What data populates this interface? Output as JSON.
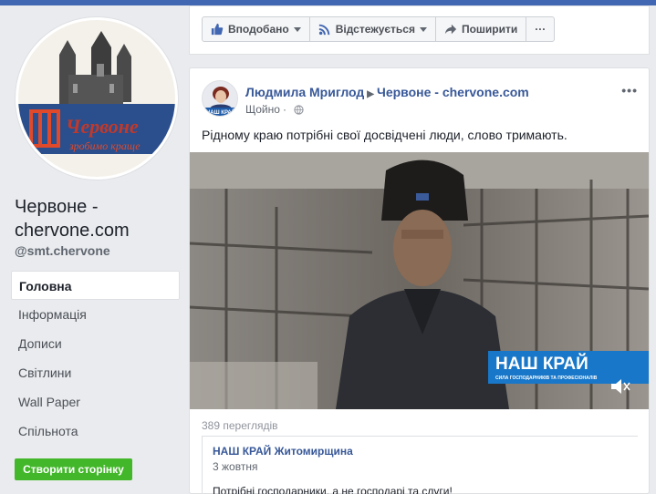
{
  "page": {
    "name": "Червоне - chervone.com",
    "handle": "@smt.chervone",
    "logo_text": "Червоне",
    "logo_tagline": "зробимо краще"
  },
  "nav": {
    "items": [
      {
        "label": "Головна",
        "active": true
      },
      {
        "label": "Інформація",
        "active": false
      },
      {
        "label": "Дописи",
        "active": false
      },
      {
        "label": "Світлини",
        "active": false
      },
      {
        "label": "Wall Paper",
        "active": false
      },
      {
        "label": "Спільнота",
        "active": false
      }
    ]
  },
  "create_page_label": "Створити сторінку",
  "actions": {
    "like": "Вподобано",
    "follow": "Відстежується",
    "share": "Поширити",
    "more": "···"
  },
  "post": {
    "author": "Людмила Мриглод",
    "target_page": "Червоне - chervone.com",
    "time": "Щойно",
    "avatar_badge": "НАШ КРАЙ",
    "text": "Рідному краю потрібні свої досвідчені люди, слово тримають.",
    "video_overlay_title": "НАШ КРАЙ",
    "video_overlay_sub": "СИЛА ГОСПОДАРНИКІВ ТА ПРОФЕСІОНАЛІВ",
    "views": "389 переглядів",
    "shared": {
      "author": "НАШ КРАЙ Житомирщина",
      "date": "3 жовтня",
      "text": "Потрібні господарники, а не господарі та слуги!"
    }
  },
  "colors": {
    "brand": "#4267b2",
    "link": "#385898",
    "create_button": "#42b72a",
    "overlay_blue": "#1877c8"
  }
}
